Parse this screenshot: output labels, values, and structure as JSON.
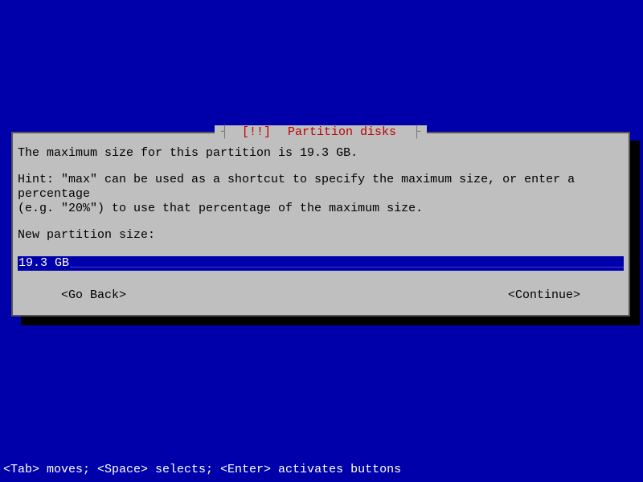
{
  "dialog": {
    "title_marker": "[!!]",
    "title": "Partition disks",
    "max_line": "The maximum size for this partition is 19.3 GB.",
    "hint_line1": "Hint: \"max\" can be used as a shortcut to specify the maximum size, or enter a percentage",
    "hint_line2": "(e.g. \"20%\") to use that percentage of the maximum size.",
    "prompt": "New partition size:",
    "input_value": "19.3 GB",
    "go_back": "<Go Back>",
    "continue": "<Continue>"
  },
  "footer": "<Tab> moves; <Space> selects; <Enter> activates buttons"
}
